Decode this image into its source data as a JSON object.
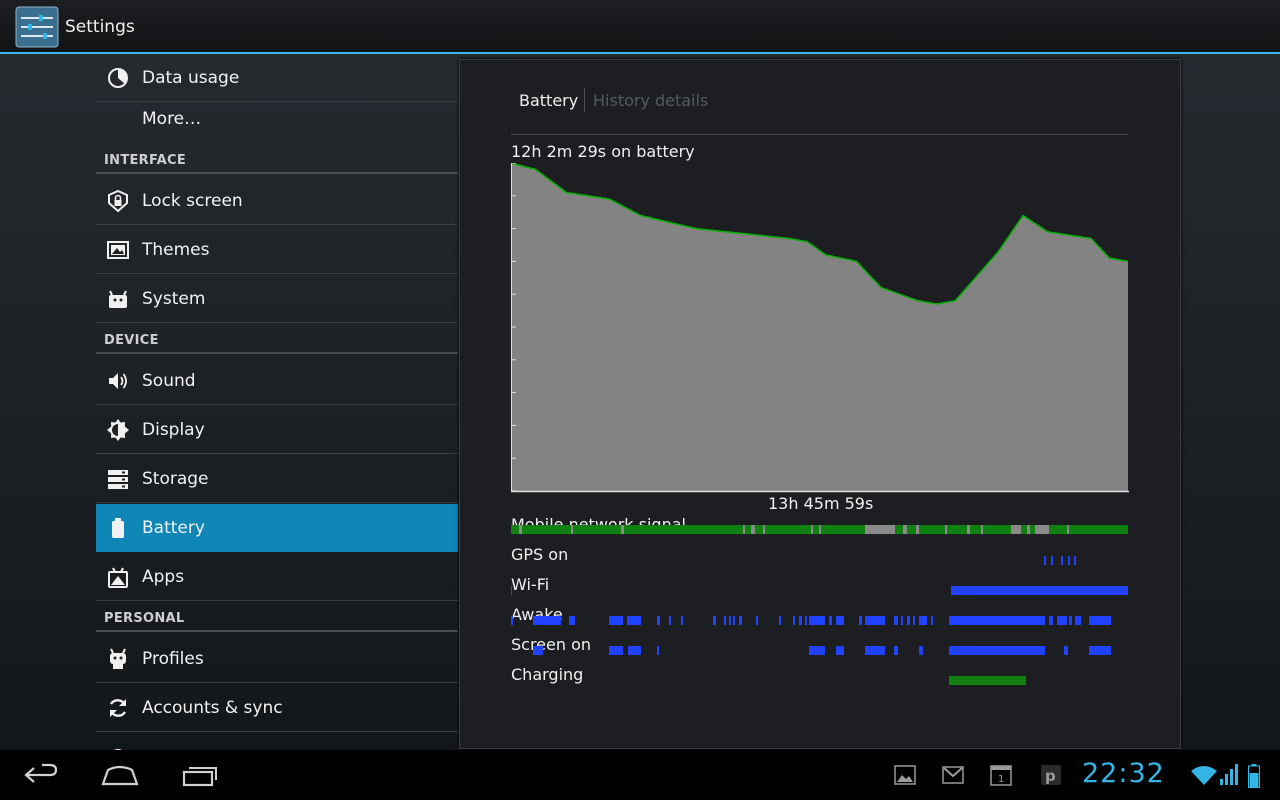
{
  "app": {
    "title": "Settings"
  },
  "settings": {
    "rows_top": [
      {
        "label": "Data usage",
        "icon": "data-usage-icon"
      },
      {
        "label": "More…",
        "icon": ""
      }
    ],
    "headers": [
      "INTERFACE",
      "DEVICE",
      "PERSONAL"
    ],
    "interface": [
      {
        "label": "Lock screen",
        "icon": "lock-icon"
      },
      {
        "label": "Themes",
        "icon": "themes-icon"
      },
      {
        "label": "System",
        "icon": "android-icon"
      }
    ],
    "device": [
      {
        "label": "Sound",
        "icon": "speaker-icon"
      },
      {
        "label": "Display",
        "icon": "brightness-icon"
      },
      {
        "label": "Storage",
        "icon": "storage-icon"
      },
      {
        "label": "Battery",
        "icon": "battery-icon",
        "selected": true
      },
      {
        "label": "Apps",
        "icon": "apps-icon"
      }
    ],
    "personal": [
      {
        "label": "Profiles",
        "icon": "profiles-icon"
      },
      {
        "label": "Accounts & sync",
        "icon": "sync-icon"
      }
    ]
  },
  "detail": {
    "tabs": {
      "battery": "Battery",
      "history": "History details"
    },
    "battery_time": "12h 2m 29s on battery",
    "duration": "13h 45m 59s",
    "tracks": {
      "mobile": "Mobile network signal",
      "gps": "GPS on",
      "wifi": "Wi-Fi",
      "awake": "Awake",
      "screen": "Screen on",
      "charging": "Charging"
    }
  },
  "chart_data": {
    "type": "area",
    "y_range_percent": [
      0,
      100
    ],
    "x_range_fraction": [
      0,
      1
    ],
    "battery_level_percent": [
      [
        0,
        100
      ],
      [
        0.04,
        98
      ],
      [
        0.09,
        91
      ],
      [
        0.16,
        89
      ],
      [
        0.21,
        84
      ],
      [
        0.3,
        80
      ],
      [
        0.45,
        77
      ],
      [
        0.48,
        76
      ],
      [
        0.51,
        72
      ],
      [
        0.56,
        70
      ],
      [
        0.6,
        62
      ],
      [
        0.66,
        58
      ],
      [
        0.69,
        57
      ],
      [
        0.72,
        58
      ],
      [
        0.79,
        73
      ],
      [
        0.83,
        84
      ],
      [
        0.87,
        79
      ],
      [
        0.94,
        77
      ],
      [
        0.97,
        71
      ],
      [
        1,
        70
      ]
    ]
  },
  "colors": {
    "accent": "#33b5e5",
    "selected_row": "#0e87b6",
    "chart_fill": "#838383",
    "chart_line": "#00b200",
    "track_blue": "#2142ff",
    "track_green": "#108010"
  },
  "nav": {
    "back": "back-icon",
    "home": "home-icon",
    "recents": "recents-icon"
  },
  "status": {
    "clock": "22:32",
    "notifications": [
      "gallery-icon",
      "gmail-icon",
      "calendar-icon",
      "p-app-icon"
    ]
  }
}
